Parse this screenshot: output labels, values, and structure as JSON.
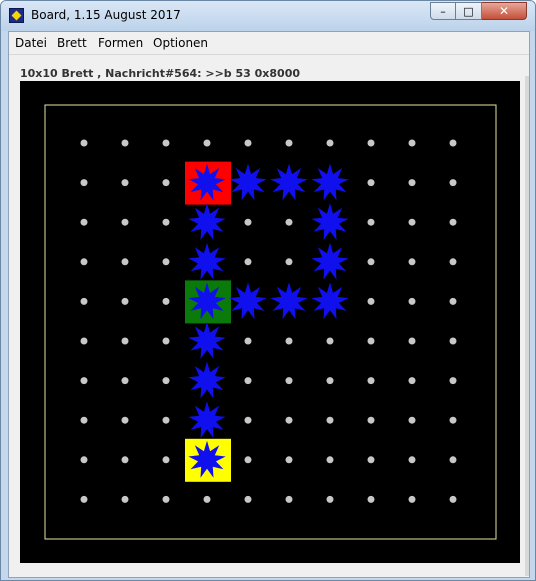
{
  "window": {
    "title": "Board, 1.15 August 2017",
    "controls": {
      "minimize": "–",
      "maximize": "□",
      "close": "✕"
    }
  },
  "menu": {
    "items": [
      "Datei",
      "Brett",
      "Formen",
      "Optionen"
    ]
  },
  "status": {
    "text": "10x10 Brett , Nachricht#564: >>b 53 0x8000"
  },
  "board": {
    "cols": 10,
    "rows": 10,
    "background": "#000000",
    "dot_color": "#c8c8c8",
    "frame_color": "#e6e6a0",
    "star_color": "#1010ee",
    "stars": [
      {
        "col": 3,
        "row": 1,
        "bg": "#ff0000"
      },
      {
        "col": 4,
        "row": 1
      },
      {
        "col": 5,
        "row": 1
      },
      {
        "col": 6,
        "row": 1
      },
      {
        "col": 3,
        "row": 2
      },
      {
        "col": 6,
        "row": 2
      },
      {
        "col": 3,
        "row": 3
      },
      {
        "col": 6,
        "row": 3
      },
      {
        "col": 3,
        "row": 4,
        "bg": "#0a7a0a"
      },
      {
        "col": 4,
        "row": 4
      },
      {
        "col": 5,
        "row": 4
      },
      {
        "col": 6,
        "row": 4
      },
      {
        "col": 3,
        "row": 5
      },
      {
        "col": 3,
        "row": 6
      },
      {
        "col": 3,
        "row": 7
      },
      {
        "col": 3,
        "row": 8,
        "bg": "#ffff00"
      }
    ]
  }
}
